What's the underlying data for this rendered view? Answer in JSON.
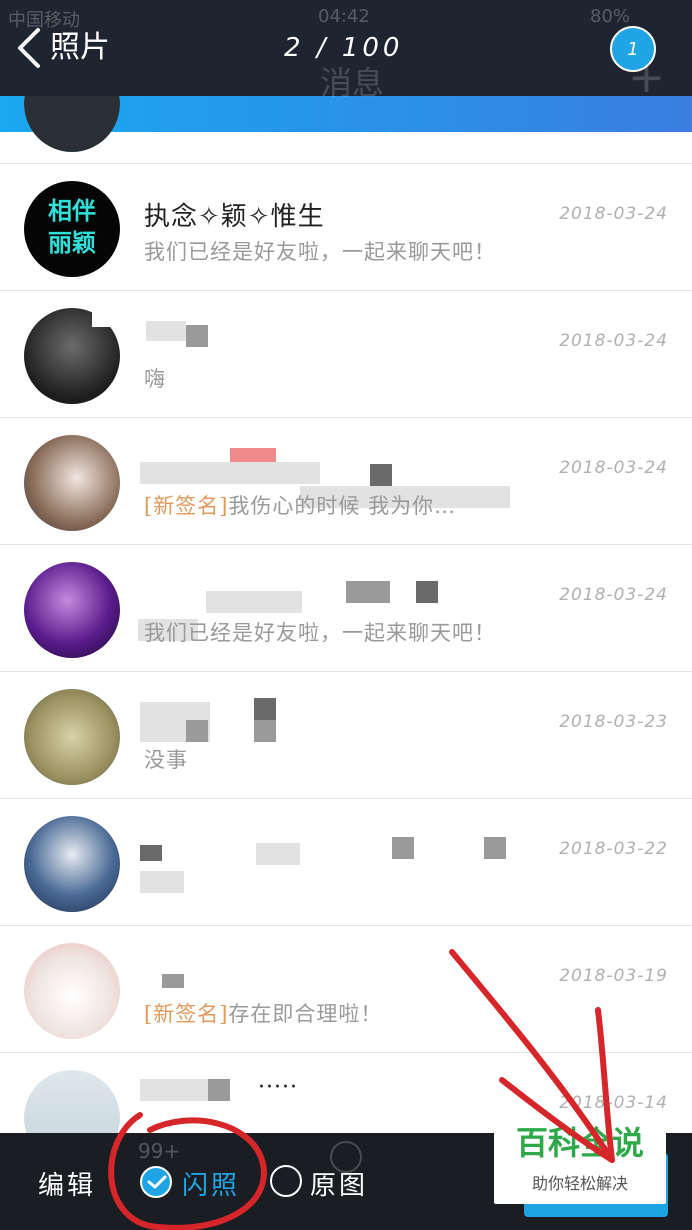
{
  "status_bar": {
    "carrier": "中国移动",
    "time": "04:42",
    "battery": "80%"
  },
  "header": {
    "title": "照片",
    "counter": "2 / 100",
    "selected_count": "1",
    "underlay_title": "消息",
    "underlay_plus": "+"
  },
  "conversations": [
    {
      "avatar_text": "相伴\n丽颖",
      "name": "执念✧颖✧惟生",
      "date": "2018-03-24",
      "message": "我们已经是好友啦，一起来聊天吧！",
      "tag": ""
    },
    {
      "avatar_text": "",
      "name": "",
      "date": "2018-03-24",
      "message": "嗨",
      "tag": ""
    },
    {
      "avatar_text": "",
      "name": "",
      "date": "2018-03-24",
      "message": "我伤心的时候 我为你…",
      "tag": "[新签名]"
    },
    {
      "avatar_text": "",
      "name": "",
      "date": "2018-03-24",
      "message": "我们已经是好友啦，一起来聊天吧！",
      "tag": ""
    },
    {
      "avatar_text": "",
      "name": "",
      "date": "2018-03-23",
      "message": "没事",
      "tag": ""
    },
    {
      "avatar_text": "",
      "name": "",
      "date": "2018-03-22",
      "message": "",
      "tag": ""
    },
    {
      "avatar_text": "",
      "name": "",
      "date": "2018-03-19",
      "message": "存在即合理啦！",
      "tag": "[新签名]"
    },
    {
      "avatar_text": "",
      "name": "·····",
      "date": "2018-03-14",
      "message": "",
      "tag": ""
    }
  ],
  "bottom_bar": {
    "edit": "编辑",
    "flash": "闪照",
    "original": "原图",
    "underlay_badge": "99+"
  },
  "watermark": {
    "title": "百科全说",
    "subtitle": "助你轻松解决"
  },
  "colors": {
    "accent_blue": "#1fa4e6",
    "annotation_red": "#d6262a",
    "tag_orange": "#e39a5a",
    "watermark_green": "#2fa84a"
  },
  "icons": [
    "back-icon",
    "check-icon",
    "radio-icon"
  ]
}
